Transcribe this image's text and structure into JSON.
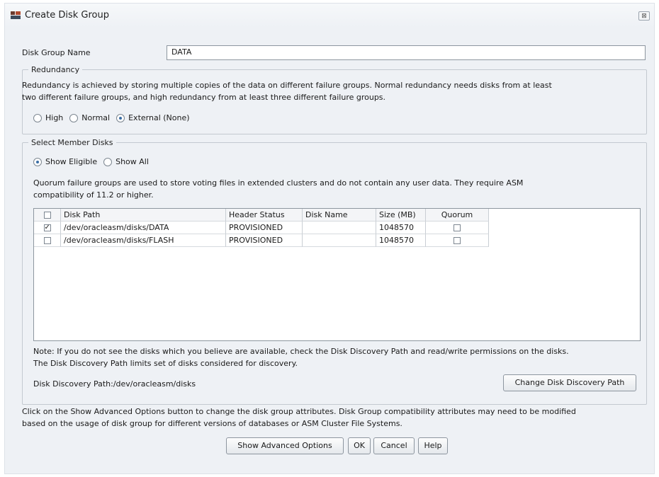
{
  "window": {
    "title": "Create Disk Group",
    "close_glyph": "⊠"
  },
  "disk_group_name": {
    "label": "Disk Group Name",
    "value": "DATA"
  },
  "redundancy": {
    "legend": "Redundancy",
    "description_line1": "Redundancy is achieved by storing multiple copies of the data on different failure groups. Normal redundancy needs disks from at least",
    "description_line2": "two different failure groups, and high redundancy from at least three different failure groups.",
    "options": [
      {
        "label": "High",
        "selected": false
      },
      {
        "label": "Normal",
        "selected": false
      },
      {
        "label": "External (None)",
        "selected": true
      }
    ]
  },
  "member_disks": {
    "legend": "Select Member Disks",
    "filter_options": [
      {
        "label": "Show Eligible",
        "selected": true
      },
      {
        "label": "Show All",
        "selected": false
      }
    ],
    "quorum_note_line1": "Quorum failure groups are used to store voting files in extended clusters and do not contain any user data. They require ASM",
    "quorum_note_line2": "compatibility of 11.2 or higher.",
    "table": {
      "columns": [
        "",
        "Disk Path",
        "Header Status",
        "Disk Name",
        "Size (MB)",
        "Quorum"
      ],
      "rows": [
        {
          "selected": true,
          "disk_path": "/dev/oracleasm/disks/DATA",
          "header_status": "PROVISIONED",
          "disk_name": "",
          "size_mb": "1048570",
          "quorum": false
        },
        {
          "selected": false,
          "disk_path": "/dev/oracleasm/disks/FLASH",
          "header_status": "PROVISIONED",
          "disk_name": "",
          "size_mb": "1048570",
          "quorum": false
        }
      ]
    },
    "note_line1": "Note: If you do not see the disks which you believe are available, check the Disk Discovery Path and read/write permissions on the disks.",
    "note_line2": "The Disk Discovery Path limits set of disks considered for discovery.",
    "discovery_path_text": "Disk Discovery Path:/dev/oracleasm/disks",
    "change_path_button": "Change Disk Discovery Path"
  },
  "footer": {
    "info_line1": "Click on the Show Advanced Options button to change the disk group attributes. Disk Group compatibility attributes may need to be modified",
    "info_line2": "based on the usage of disk group for different versions of databases or ASM Cluster File Systems.",
    "buttons": {
      "advanced": "Show Advanced Options",
      "ok": "OK",
      "cancel": "Cancel",
      "help": "Help"
    }
  }
}
